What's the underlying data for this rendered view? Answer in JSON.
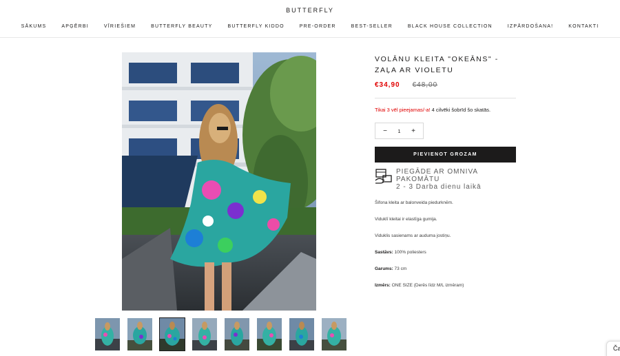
{
  "header": {
    "logo": "BUTTERFLY",
    "nav": [
      "SĀKUMS",
      "APĢĒRBI",
      "VĪRIEŠIEM",
      "BUTTERFLY BEAUTY",
      "BUTTERFLY KIDDO",
      "PRE-ORDER",
      "BEST-SELLER",
      "BLACK HOUSE COLLECTION",
      "IZPĀRDOŠANA!",
      "KONTAKTI"
    ]
  },
  "product": {
    "title": "VOLĀNU KLEITA \"OKEĀNS\" - ZAĻA AR VIOLETU",
    "price_sale": "€34,90",
    "price_old": "€48,00",
    "stock_red": "Tikai 3 vēl pieejamas/-a!",
    "stock_rest": " 4 cilvēki šobrīd šo skatās.",
    "qty_minus": "−",
    "qty_value": "1",
    "qty_plus": "+",
    "add_to_cart": "PIEVIENOT GROZAM",
    "shipping_line1": "PIEGĀDE AR OMNIVA PAKOMĀTU",
    "shipping_line2": "2 - 3 Darba dienu laikā",
    "thumb_count": 8,
    "active_thumb": 3
  },
  "description": {
    "line1": "Šifona kleita ar balonveida piedurknēm.",
    "line2": "Viduklī kleitai ir elastīga gumija.",
    "line3": "Viduklis sasienams ar auduma jostiņu.",
    "composition_label": "Sastāvs:",
    "composition_value": " 100% poliesters",
    "length_label": "Garums:",
    "length_value": " 73 cm",
    "size_label": "Izmērs:",
    "size_value": " ONE SIZE (Derēs līdz M/L izmēram)"
  },
  "chat": {
    "label": "Ča"
  },
  "colors": {
    "accent_red": "#e00000",
    "button_dark": "#1c1b1b"
  }
}
